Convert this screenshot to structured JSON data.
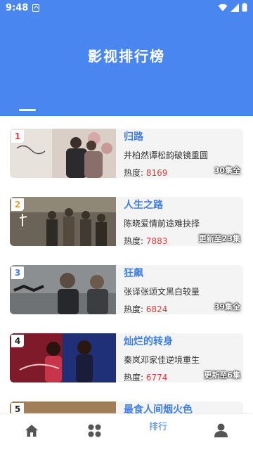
{
  "status_bar": {
    "time": "9:48"
  },
  "header": {
    "title": "影视排行榜",
    "background_color": "#4a86f0"
  },
  "tabs": [
    {
      "label": "",
      "active": true
    },
    {
      "label": "",
      "active": false
    },
    {
      "label": "",
      "active": false
    },
    {
      "label": "",
      "active": false
    },
    {
      "label": "",
      "active": false
    }
  ],
  "rankings": [
    {
      "rank": "1",
      "title": "归路",
      "description": "井柏然谭松韵破镜重圆",
      "heat_label": "热度:",
      "heat_value": "8169",
      "episodes": "30集全",
      "rank_color": "#e04545"
    },
    {
      "rank": "2",
      "title": "人生之路",
      "description": "陈晓爱情前途难抉择",
      "heat_label": "热度:",
      "heat_value": "7883",
      "episodes": "更新至23集",
      "rank_color": "#e8a03a"
    },
    {
      "rank": "3",
      "title": "狂飙",
      "description": "张译张颂文黑白较量",
      "heat_label": "热度:",
      "heat_value": "6824",
      "episodes": "39集全",
      "rank_color": "#3f7fe6"
    },
    {
      "rank": "4",
      "title": "灿烂的转身",
      "description": "秦岚邓家佳逆境重生",
      "heat_label": "热度:",
      "heat_value": "6774",
      "episodes": "更新至6集",
      "rank_color": "#222222"
    },
    {
      "rank": "5",
      "title": "最食人间烟火色",
      "description": "",
      "heat_label": "",
      "heat_value": "",
      "episodes": "",
      "rank_color": "#222222"
    }
  ],
  "bottom_nav": [
    {
      "icon": "home-icon",
      "label": ""
    },
    {
      "icon": "grid-icon",
      "label": ""
    },
    {
      "icon": "ranking",
      "label": "排行"
    },
    {
      "icon": "user-icon",
      "label": ""
    }
  ],
  "colors": {
    "accent": "#3f7fe6",
    "heat": "#e03a3a"
  }
}
